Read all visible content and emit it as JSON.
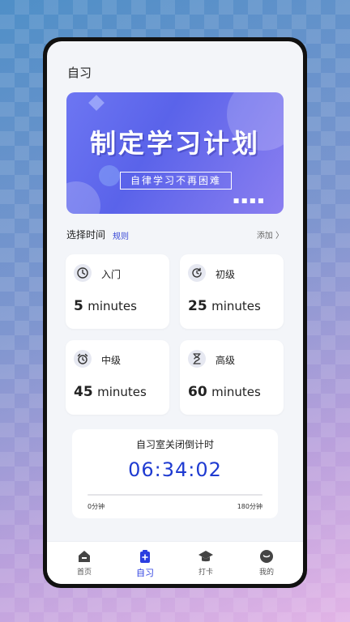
{
  "app": {
    "title": "自习"
  },
  "banner": {
    "headline": "制定学习计划",
    "tagline": "自律学习不再困难"
  },
  "section": {
    "title": "选择时间",
    "rule": "规则",
    "add": "添加 〉"
  },
  "levels": [
    {
      "icon": "clock-icon",
      "label": "入门",
      "num": "5",
      "unit": "minutes"
    },
    {
      "icon": "refresh-clock-icon",
      "label": "初级",
      "num": "25",
      "unit": "minutes"
    },
    {
      "icon": "alarm-clock-icon",
      "label": "中级",
      "num": "45",
      "unit": "minutes"
    },
    {
      "icon": "hourglass-icon",
      "label": "高级",
      "num": "60",
      "unit": "minutes"
    }
  ],
  "timer": {
    "title": "自习室关闭倒计时",
    "time": "06:34:02",
    "min_label": "0分钟",
    "max_label": "180分钟",
    "progress": 0.0
  },
  "tabs": [
    {
      "icon": "home-icon",
      "label": "首页",
      "active": false
    },
    {
      "icon": "study-icon",
      "label": "自习",
      "active": true
    },
    {
      "icon": "graduation-cap-icon",
      "label": "打卡",
      "active": false
    },
    {
      "icon": "profile-icon",
      "label": "我的",
      "active": false
    }
  ],
  "colors": {
    "accent": "#2b3ee0",
    "timer": "#1f3bd1",
    "banner": "#5a63ea"
  }
}
